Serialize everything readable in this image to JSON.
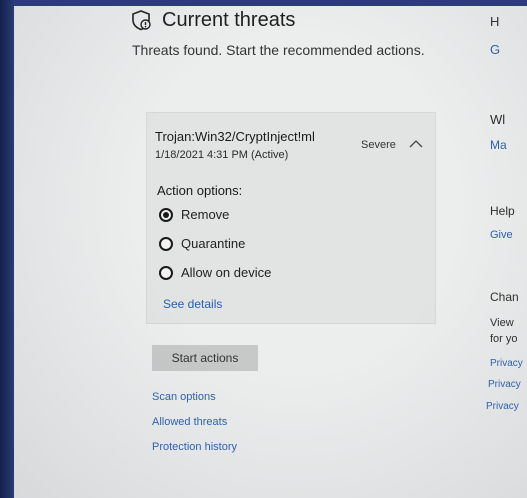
{
  "header": {
    "title": "Current threats",
    "subtitle": "Threats found. Start the recommended actions."
  },
  "threat": {
    "name": "Trojan:Win32/CryptInject!ml",
    "date": "1/18/2021 4:31 PM (Active)",
    "severity": "Severe"
  },
  "actions": {
    "label": "Action options:",
    "options": [
      "Remove",
      "Quarantine",
      "Allow on device"
    ],
    "selected": "Remove",
    "see_details": "See details"
  },
  "start_button": "Start actions",
  "links": {
    "scan_options": "Scan options",
    "allowed_threats": "Allowed threats",
    "protection_history": "Protection history"
  },
  "right_column": {
    "h": "H",
    "g": "G",
    "wl": "Wl",
    "ma": "Ma",
    "help": "Help",
    "give": "Give",
    "chan": "Chan",
    "view": "View",
    "foryo": "for yo",
    "privacy1": "Privacy",
    "privacy2": "Privacy",
    "privacy3": "Privacy"
  },
  "colors": {
    "link": "#2a5fb0",
    "card": "#e2e3e3",
    "button": "#c7c8c8",
    "background": "#eceeee"
  }
}
